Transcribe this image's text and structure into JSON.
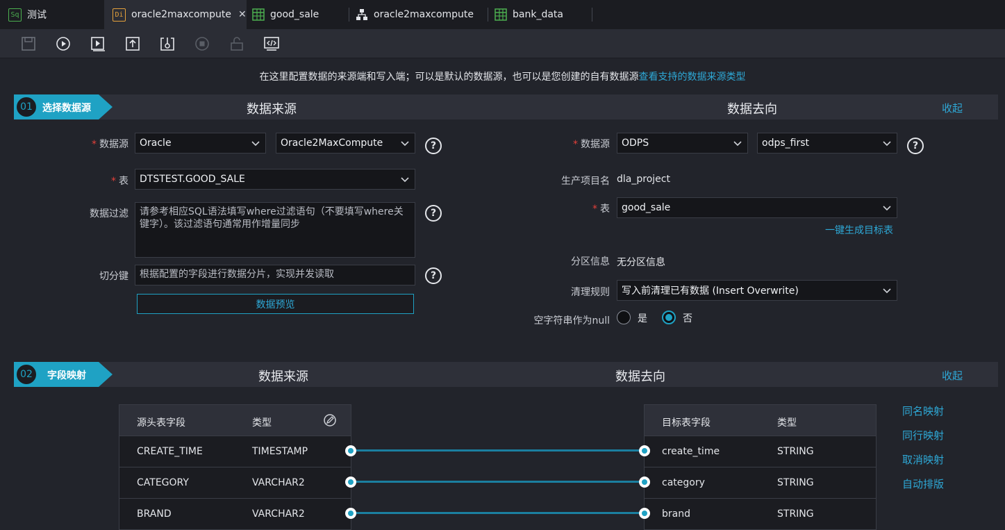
{
  "tabs": [
    {
      "label": "测试",
      "icon_text": "Sq",
      "icon": "sql-icon",
      "color": "#4caf50"
    },
    {
      "label": "oracle2maxcompute",
      "icon_text": "Di",
      "icon": "di-icon",
      "color": "#e6a23c",
      "active": true,
      "closable": true
    },
    {
      "label": "good_sale",
      "icon": "table-icon",
      "color": "#4caf50"
    },
    {
      "label": "oracle2maxcompute",
      "icon": "workflow-icon",
      "color": "#e4e6ea"
    },
    {
      "label": "bank_data",
      "icon": "table-icon",
      "color": "#4caf50"
    }
  ],
  "toolbar": [
    "save-icon",
    "run-icon",
    "run-params-icon",
    "submit-icon",
    "deploy-icon",
    "stop-icon",
    "lock-icon",
    "code-icon"
  ],
  "intro": {
    "text": "在这里配置数据的来源端和写入端；可以是默认的数据源，也可以是您创建的自有数据源",
    "link": "查看支持的数据来源类型"
  },
  "step1": {
    "num": "01",
    "label": "选择数据源",
    "source_title": "数据来源",
    "target_title": "数据去向",
    "collapse": "收起",
    "source": {
      "datasource_label": "数据源",
      "datasource_type": "Oracle",
      "datasource_name": "Oracle2MaxCompute",
      "table_label": "表",
      "table_value": "DTSTEST.GOOD_SALE",
      "filter_label": "数据过滤",
      "filter_placeholder": "请参考相应SQL语法填写where过滤语句（不要填写where关键字）。该过滤语句通常用作增量同步",
      "split_label": "切分键",
      "split_placeholder": "根据配置的字段进行数据分片，实现并发读取",
      "preview_button": "数据预览"
    },
    "target": {
      "datasource_label": "数据源",
      "datasource_type": "ODPS",
      "datasource_name": "odps_first",
      "project_label": "生产项目名",
      "project_value": "dla_project",
      "table_label": "表",
      "table_value": "good_sale",
      "gen_table_link": "一键生成目标表",
      "partition_label": "分区信息",
      "partition_value": "无分区信息",
      "clean_label": "清理规则",
      "clean_value": "写入前清理已有数据 (Insert Overwrite)",
      "null_label": "空字符串作为null",
      "null_yes": "是",
      "null_no": "否",
      "null_selected": "否"
    }
  },
  "step2": {
    "num": "02",
    "label": "字段映射",
    "source_title": "数据来源",
    "target_title": "数据去向",
    "collapse": "收起",
    "source_headers": [
      "源头表字段",
      "类型"
    ],
    "target_headers": [
      "目标表字段",
      "类型"
    ],
    "source_rows": [
      [
        "CREATE_TIME",
        "TIMESTAMP"
      ],
      [
        "CATEGORY",
        "VARCHAR2"
      ],
      [
        "BRAND",
        "VARCHAR2"
      ]
    ],
    "target_rows": [
      [
        "create_time",
        "STRING"
      ],
      [
        "category",
        "STRING"
      ],
      [
        "brand",
        "STRING"
      ]
    ],
    "actions": [
      "同名映射",
      "同行映射",
      "取消映射",
      "自动排版"
    ]
  },
  "colors": {
    "accent": "#1fa2c4",
    "link": "#2ea8d6",
    "required": "#e5403a"
  }
}
